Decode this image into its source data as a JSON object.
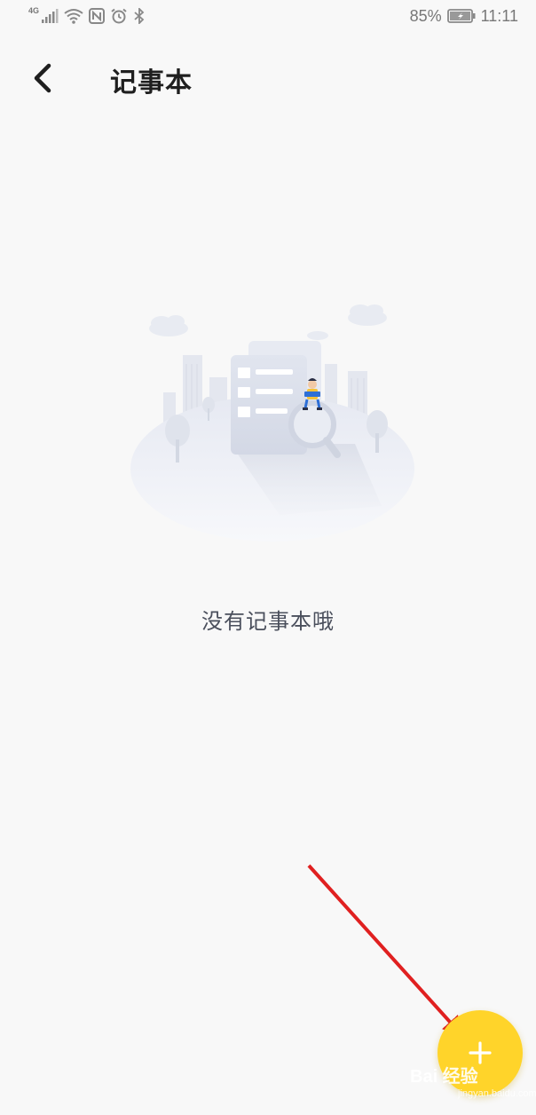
{
  "status_bar": {
    "network_label": "4G",
    "battery": "85%",
    "time": "11:11",
    "icons": [
      "signal-icon",
      "wifi-icon",
      "nfc-icon",
      "alarm-icon",
      "bluetooth-icon",
      "battery-icon"
    ]
  },
  "header": {
    "back_icon": "chevron-left-icon",
    "title": "记事本"
  },
  "empty_state": {
    "illustration": "empty-notebook-illustration",
    "message": "没有记事本哦"
  },
  "fab": {
    "icon": "plus-icon",
    "color": "#ffd42a"
  },
  "watermark": {
    "text": "Bai 经验",
    "subtext": "jingyan.baidu.com"
  },
  "colors": {
    "background": "#f8f8f8",
    "accent": "#ffd42a",
    "annotation_arrow": "#e02020"
  }
}
